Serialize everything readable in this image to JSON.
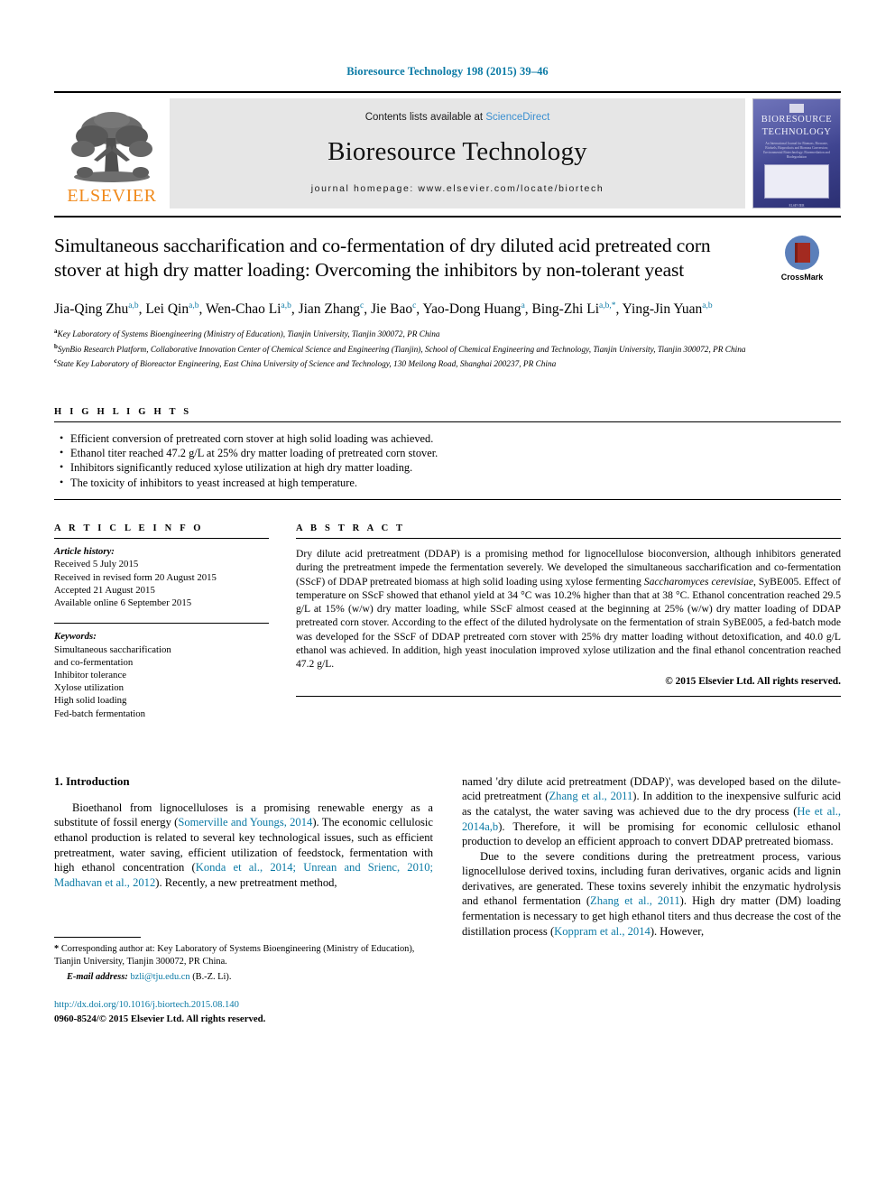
{
  "running_head": "Bioresource Technology 198 (2015) 39–46",
  "masthead": {
    "publisher": "ELSEVIER",
    "contents_prefix": "Contents lists available at ",
    "contents_link": "ScienceDirect",
    "journal_title": "Bioresource Technology",
    "homepage": "journal homepage: www.elsevier.com/locate/biortech",
    "cover": {
      "line1": "BIORESOURCE",
      "line2": "TECHNOLOGY",
      "subtitle": "An International Journal for Biomass, Biowaste, Biofuels, Bioproducts and Biomass Conversion; Environmental Biotechnology; Bioremediation and Biodegradation",
      "footer": "ELSEVIER"
    }
  },
  "article": {
    "title": "Simultaneous saccharification and co-fermentation of dry diluted acid pretreated corn stover at high dry matter loading: Overcoming the inhibitors by non-tolerant yeast",
    "crossmark_label": "CrossMark",
    "authors": [
      {
        "name": "Jia-Qing Zhu",
        "sup": "a,b"
      },
      {
        "name": "Lei Qin",
        "sup": "a,b"
      },
      {
        "name": "Wen-Chao Li",
        "sup": "a,b"
      },
      {
        "name": "Jian Zhang",
        "sup": "c"
      },
      {
        "name": "Jie Bao",
        "sup": "c"
      },
      {
        "name": "Yao-Dong Huang",
        "sup": "a"
      },
      {
        "name": "Bing-Zhi Li",
        "sup": "a,b,*"
      },
      {
        "name": "Ying-Jin Yuan",
        "sup": "a,b"
      }
    ],
    "affiliations": [
      {
        "marker": "a",
        "text": "Key Laboratory of Systems Bioengineering (Ministry of Education), Tianjin University, Tianjin 300072, PR China"
      },
      {
        "marker": "b",
        "text": "SynBio Research Platform, Collaborative Innovation Center of Chemical Science and Engineering (Tianjin), School of Chemical Engineering and Technology, Tianjin University, Tianjin 300072, PR China"
      },
      {
        "marker": "c",
        "text": "State Key Laboratory of Bioreactor Engineering, East China University of Science and Technology, 130 Meilong Road, Shanghai 200237, PR China"
      }
    ]
  },
  "highlights": {
    "heading": "H I G H L I G H T S",
    "items": [
      "Efficient conversion of pretreated corn stover at high solid loading was achieved.",
      "Ethanol titer reached 47.2 g/L at 25% dry matter loading of pretreated corn stover.",
      "Inhibitors significantly reduced xylose utilization at high dry matter loading.",
      "The toxicity of inhibitors to yeast increased at high temperature."
    ]
  },
  "article_info": {
    "heading": "A R T I C L E    I N F O",
    "history_label": "Article history:",
    "history": [
      "Received 5 July 2015",
      "Received in revised form 20 August 2015",
      "Accepted 21 August 2015",
      "Available online 6 September 2015"
    ],
    "keywords_label": "Keywords:",
    "keywords": [
      "Simultaneous saccharification",
      "and co-fermentation",
      "Inhibitor tolerance",
      "Xylose utilization",
      "High solid loading",
      "Fed-batch fermentation"
    ]
  },
  "abstract": {
    "heading": "A B S T R A C T",
    "p1_a": "Dry dilute acid pretreatment (DDAP) is a promising method for lignocellulose bioconversion, although inhibitors generated during the pretreatment impede the fermentation severely. We developed the simultaneous saccharification and co-fermentation (SScF) of DDAP pretreated biomass at high solid loading using xylose fermenting ",
    "p1_italic": "Saccharomyces cerevisiae",
    "p1_b": ", SyBE005. Effect of temperature on SScF showed that ethanol yield at 34 °C was 10.2% higher than that at 38 °C. Ethanol concentration reached 29.5 g/L at 15% (w/w) dry matter loading, while SScF almost ceased at the beginning at 25% (w/w) dry matter loading of DDAP pretreated corn stover. According to the effect of the diluted hydrolysate on the fermentation of strain SyBE005, a fed-batch mode was developed for the SScF of DDAP pretreated corn stover with 25% dry matter loading without detoxification, and 40.0 g/L ethanol was achieved. In addition, high yeast inoculation improved xylose utilization and the final ethanol concentration reached 47.2 g/L.",
    "copyright": "© 2015 Elsevier Ltd. All rights reserved."
  },
  "introduction": {
    "section_title": "1. Introduction",
    "left_p1_a": "Bioethanol from lignocelluloses is a promising renewable energy as a substitute of fossil energy (",
    "left_ref1": "Somerville and Youngs, 2014",
    "left_p1_b": "). The economic cellulosic ethanol production is related to several key technological issues, such as efficient pretreatment, water saving, efficient utilization of feedstock, fermentation with high ethanol concentration (",
    "left_ref2": "Konda et al., 2014; Unrean and Srienc, 2010; Madhavan et al., 2012",
    "left_p1_c": "). Recently, a new pretreatment method,",
    "right_p1_a": "named 'dry dilute acid pretreatment (DDAP)', was developed based on the dilute-acid pretreatment (",
    "right_ref1": "Zhang et al., 2011",
    "right_p1_b": "). In addition to the inexpensive sulfuric acid as the catalyst, the water saving was achieved due to the dry process (",
    "right_ref2": "He et al., 2014a,b",
    "right_p1_c": "). Therefore, it will be promising for economic cellulosic ethanol production to develop an efficient approach to convert DDAP pretreated biomass.",
    "right_p2_a": "Due to the severe conditions during the pretreatment process, various lignocellulose derived toxins, including furan derivatives, organic acids and lignin derivatives, are generated. These toxins severely inhibit the enzymatic hydrolysis and ethanol fermentation (",
    "right_ref3": "Zhang et al., 2011",
    "right_p2_b": "). High dry matter (DM) loading fermentation is necessary to get high ethanol titers and thus decrease the cost of the distillation process (",
    "right_ref4": "Koppram et al., 2014",
    "right_p2_c": "). However,"
  },
  "footer": {
    "corresponding_star": "*",
    "corresponding_text": "Corresponding author at: Key Laboratory of Systems Bioengineering (Ministry of Education), Tianjin University, Tianjin 300072, PR China.",
    "email_label": "E-mail address:",
    "email": "bzli@tju.edu.cn",
    "email_suffix": "(B.-Z. Li).",
    "doi": "http://dx.doi.org/10.1016/j.biortech.2015.08.140",
    "issn": "0960-8524/© 2015 Elsevier Ltd. All rights reserved."
  },
  "colors": {
    "link": "#0b7aa5",
    "sciencedirect": "#3a8fd0",
    "elsevier_orange": "#f08a1c",
    "band_gray": "#e6e6e6"
  }
}
